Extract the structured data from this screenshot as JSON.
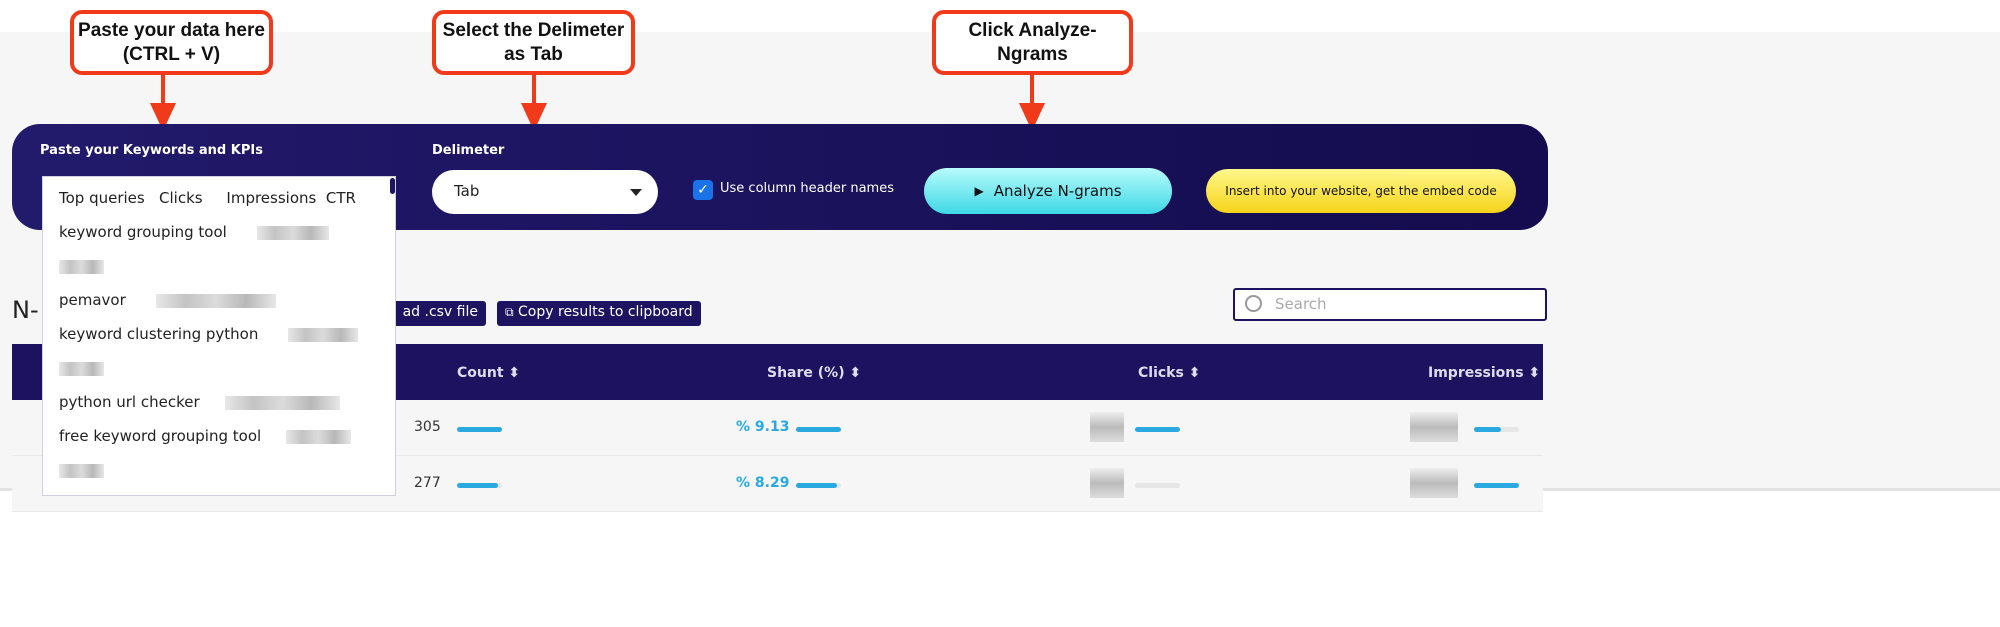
{
  "callouts": [
    "Paste your data here\n(CTRL + V)",
    "Select the Delimeter\nas Tab",
    "Click Analyze-\nNgrams"
  ],
  "callout_lines": [
    [
      "Paste your data here",
      "(CTRL + V)"
    ],
    [
      "Select the Delimeter",
      "as Tab"
    ],
    [
      "Click Analyze-",
      "Ngrams"
    ]
  ],
  "input": {
    "label": "Paste your Keywords and KPIs",
    "lines": [
      "Top queries   Clicks     Impressions  CTR",
      "keyword grouping tool",
      "",
      "pemavor",
      "keyword clustering python",
      "",
      "python url checker",
      "free keyword grouping tool",
      ""
    ]
  },
  "delimiter": {
    "label": "Delimeter",
    "value": "Tab"
  },
  "header_checkbox": {
    "label": "Use column header names",
    "checked": true
  },
  "analyze_button": "Analyze N-grams",
  "embed_button": "Insert into your website, get the embed code",
  "results": {
    "heading": "N-",
    "download_label": "ad .csv file",
    "copy_label": "Copy results to clipboard",
    "search_placeholder": "Search"
  },
  "table": {
    "columns": [
      "Count",
      "Share (%)",
      "Clicks",
      "Impressions"
    ],
    "rows": [
      {
        "count": "305",
        "share": "% 9.13",
        "count_fill": 1,
        "share_fill": 1,
        "clicks_fill": 1,
        "impr_fill": 0.6
      },
      {
        "count": "277",
        "share": "% 8.29",
        "count_fill": 0.91,
        "share_fill": 0.91,
        "clicks_fill": 0,
        "impr_fill": 1
      }
    ]
  },
  "colors": {
    "navy": "#1c1260",
    "accent": "#29a9e0",
    "callout": "#f03a1a"
  }
}
